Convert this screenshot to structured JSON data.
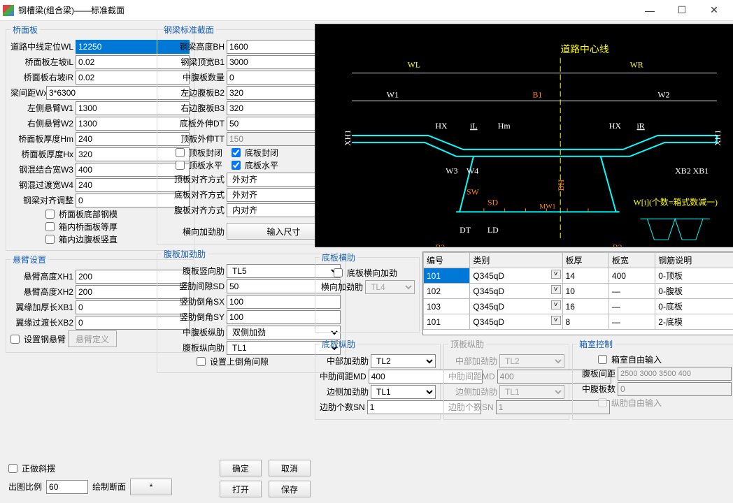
{
  "window": {
    "title": "钢槽梁(组合梁)——标准截面"
  },
  "deck": {
    "legend": "桥面板",
    "wl_label": "道路中线定位WL",
    "wl": "12250",
    "il_label": "桥面板左坡iL",
    "il": "0.02",
    "ir_label": "桥面板右坡iR",
    "ir": "0.02",
    "wx_label": "梁间距Wx",
    "wx": "3*6300",
    "w1_label": "左侧悬臂W1",
    "w1": "1300",
    "w2_label": "右侧悬臂W2",
    "w2": "1300",
    "hm_label": "桥面板厚度Hm",
    "hm": "240",
    "hx_label": "桥面板厚度Hx",
    "hx": "320",
    "w3_label": "钢混结合宽W3",
    "w3": "400",
    "w4_label": "钢混过渡宽W4",
    "w4": "240",
    "align_label": "钢梁对齐调整",
    "align": "0",
    "chk1": "桥面板底部钢模",
    "chk2": "箱内桥面板等厚",
    "chk3": "箱内边腹板竖直"
  },
  "cant": {
    "legend": "悬臂设置",
    "xh1_label": "悬臂高度XH1",
    "xh1": "200",
    "xh2_label": "悬臂高度XH2",
    "xh2": "200",
    "xb1_label": "翼缘加厚长XB1",
    "xb1": "0",
    "xb2_label": "翼缘过渡长XB2",
    "xb2": "0",
    "chk_steel": "设置钢悬臂",
    "btn_def": "悬臂定义"
  },
  "section": {
    "legend": "钢梁标准截面",
    "bh_label": "钢梁高度BH",
    "bh": "1600",
    "b1_label": "钢梁顶宽B1",
    "b1": "3000",
    "mid_label": "中腹板数量",
    "mid": "0",
    "b2_label": "左边腹板B2",
    "b2": "320",
    "b3_label": "右边腹板B3",
    "b3": "320",
    "dt_label": "底板外伸DT",
    "dt": "50",
    "tt_label": "顶板外伸TT",
    "tt": "150",
    "chk_top_close": "顶板封闭",
    "chk_bot_close": "底板封闭",
    "chk_top_flat": "顶板水平",
    "chk_bot_flat": "底板水平",
    "top_align_label": "顶板对齐方式",
    "top_align": "外对齐",
    "bot_align_label": "底板对齐方式",
    "bot_align": "外对齐",
    "web_align_label": "腹板对齐方式",
    "web_align": "内对齐",
    "trans_stiff_label": "横向加劲肋",
    "trans_stiff_btn": "输入尺寸"
  },
  "webstiff": {
    "legend": "腹板加劲肋",
    "vert_label": "腹板竖向肋",
    "vert": "TL5",
    "sd_label": "竖肋间隙SD",
    "sd": "50",
    "sx_label": "竖肋倒角SX",
    "sx": "100",
    "sy_label": "竖肋倒角SY",
    "sy": "100",
    "mid_long_label": "中腹板纵肋",
    "mid_long": "双侧加劲",
    "web_long_label": "腹板纵向肋",
    "web_long": "TL1",
    "chk_gap": "设置上倒角间隙"
  },
  "bottrans": {
    "legend": "底板横肋",
    "chk": "底板横向加劲",
    "trans_label": "横向加劲肋",
    "trans": "TL4"
  },
  "table": {
    "headers": [
      "编号",
      "类别",
      "板厚",
      "板宽",
      "钢筋说明"
    ],
    "rows": [
      {
        "num": "101",
        "cat": "Q345qD",
        "th": "14",
        "w": "400",
        "desc": "0-顶板"
      },
      {
        "num": "102",
        "cat": "Q345qD",
        "th": "10",
        "w": "—",
        "desc": "0-腹板"
      },
      {
        "num": "103",
        "cat": "Q345qD",
        "th": "16",
        "w": "—",
        "desc": "0-底板"
      },
      {
        "num": "101",
        "cat": "Q345qD",
        "th": "8",
        "w": "—",
        "desc": "2-底模"
      }
    ]
  },
  "botlong": {
    "legend": "底板纵肋",
    "mid_label": "中部加劲肋",
    "mid": "TL2",
    "md_label": "中肋间距MD",
    "md": "400",
    "edge_label": "边侧加劲肋",
    "edge": "TL1",
    "sn_label": "边肋个数SN",
    "sn": "1"
  },
  "toplong": {
    "legend": "顶板纵肋",
    "mid_label": "中部加劲肋",
    "mid": "TL2",
    "md_label": "中肋间距MD",
    "md": "400",
    "edge_label": "边侧加劲肋",
    "edge": "TL1",
    "sn_label": "边肋个数SN",
    "sn": "1"
  },
  "box": {
    "legend": "箱室控制",
    "chk_free": "箱室自由输入",
    "web_sp_label": "腹板间距",
    "web_sp": "2500 3000 3500 400",
    "mid_n_label": "中腹板数",
    "mid_n": "0",
    "chk_longfree": "纵肋自由输入"
  },
  "footer": {
    "chk_skew": "正做斜摆",
    "scale_label": "出图比例",
    "scale": "60",
    "draw_label": "绘制断面",
    "ok": "确定",
    "cancel": "取消",
    "open": "打开",
    "save": "保存"
  }
}
